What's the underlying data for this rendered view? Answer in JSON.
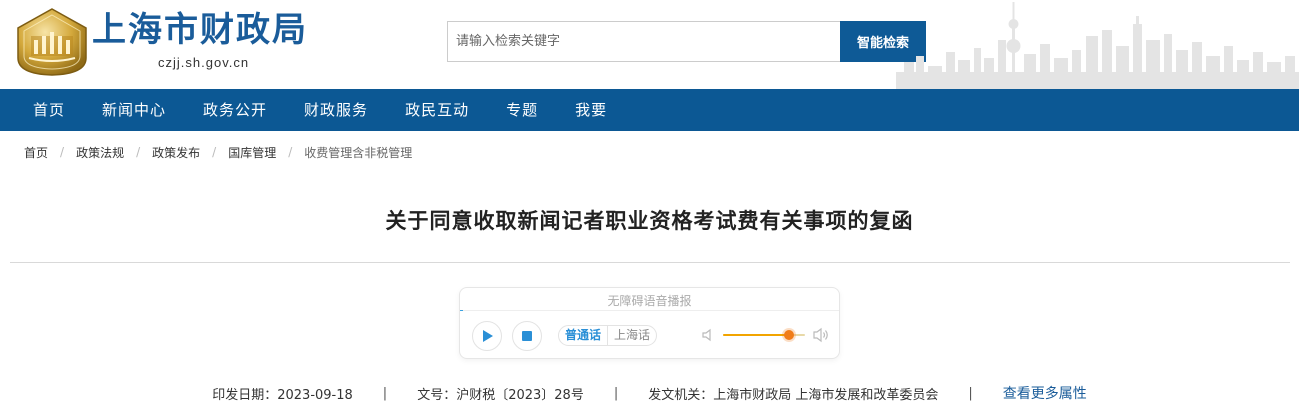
{
  "header": {
    "site_title": "上海市财政局",
    "site_domain": "czjj.sh.gov.cn",
    "search_placeholder": "请输入检索关键字",
    "search_button": "智能检索"
  },
  "nav": {
    "items": [
      "首页",
      "新闻中心",
      "政务公开",
      "财政服务",
      "政民互动",
      "专题",
      "我要"
    ]
  },
  "breadcrumb": {
    "items": [
      "首页",
      "政策法规",
      "政策发布",
      "国库管理",
      "收费管理含非税管理"
    ]
  },
  "article": {
    "title": "关于同意收取新闻记者职业资格考试费有关事项的复函"
  },
  "player": {
    "label": "无障碍语音播报",
    "languages": [
      "普通话",
      "上海话"
    ],
    "active_language": "普通话",
    "volume_level": 0.8
  },
  "meta": {
    "date": "印发日期：2023-09-18",
    "doc_no": "文号：沪财税〔2023〕28号",
    "issuer": "发文机关：上海市财政局 上海市发展和改革委员会",
    "more_link": "查看更多属性",
    "separator": "|"
  },
  "colors": {
    "brand_blue": "#0c5894",
    "title_blue": "#1a5c9a",
    "player_accent": "#2a8fd6",
    "volume_orange": "#f07d1a"
  }
}
